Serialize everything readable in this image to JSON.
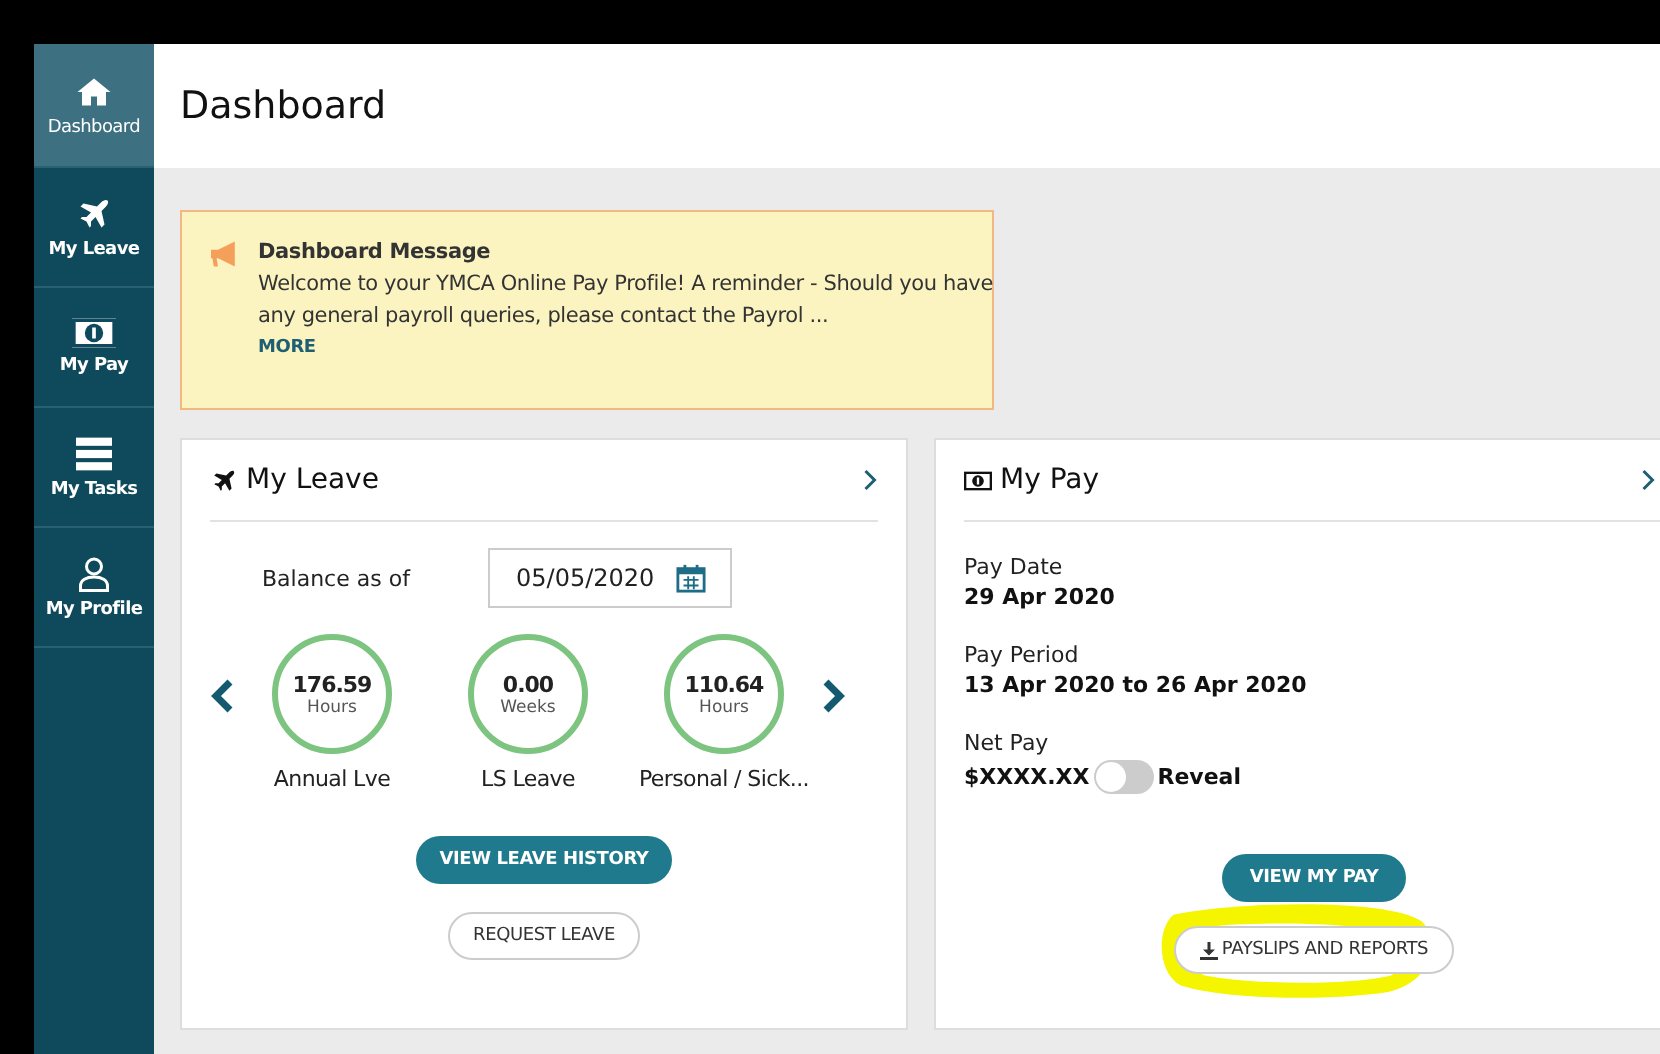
{
  "sidebar": {
    "items": [
      {
        "label": "Dashboard",
        "selected": true
      },
      {
        "label": "My Leave",
        "selected": false
      },
      {
        "label": "My Pay",
        "selected": false
      },
      {
        "label": "My Tasks",
        "selected": false
      },
      {
        "label": "My Profile",
        "selected": false
      }
    ]
  },
  "page_title": "Dashboard",
  "message": {
    "title": "Dashboard Message",
    "text": "Welcome to your YMCA Online Pay Profile! A reminder - Should you have any general payroll queries, please contact the Payrol ...",
    "link": "MORE"
  },
  "leave_card": {
    "title": "My Leave",
    "balance_label": "Balance as of",
    "date": "05/05/2020",
    "balances": [
      {
        "value": "176.59",
        "unit": "Hours",
        "label": "Annual Lve"
      },
      {
        "value": "0.00",
        "unit": "Weeks",
        "label": "LS Leave"
      },
      {
        "value": "110.64",
        "unit": "Hours",
        "label": "Personal / Sick..."
      }
    ],
    "buttons": [
      {
        "label": "VIEW LEAVE HISTORY",
        "kind": "primary"
      },
      {
        "label": "REQUEST LEAVE",
        "kind": "secondary"
      }
    ]
  },
  "pay_card": {
    "title": "My Pay",
    "fields": [
      {
        "label": "Pay Date",
        "value": "29 Apr 2020"
      },
      {
        "label": "Pay Period",
        "value": "13 Apr 2020 to 26 Apr 2020"
      }
    ],
    "net_pay": {
      "label": "Net Pay",
      "value": "$XXXX.XX",
      "toggle_label": "Reveal",
      "on": false
    },
    "buttons": [
      {
        "label": "VIEW MY PAY",
        "kind": "primary"
      },
      {
        "label": "PAYSLIPS AND REPORTS",
        "kind": "secondary",
        "highlighted": true
      }
    ]
  }
}
